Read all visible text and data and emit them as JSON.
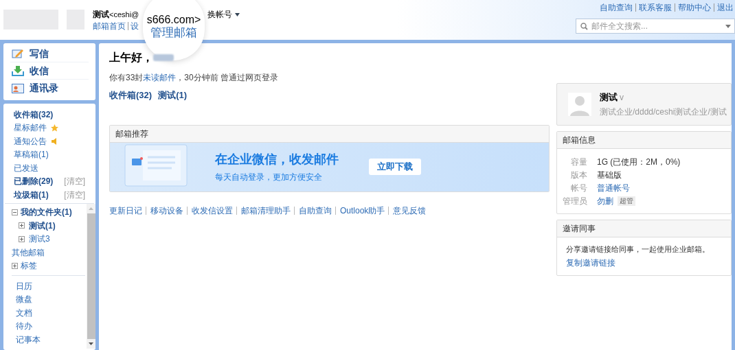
{
  "header": {
    "account_name": "测试",
    "email_visible": "<ceshi@",
    "switch_account": "换帐号",
    "links": [
      "邮箱首页",
      "设"
    ],
    "magnifier": {
      "top_text": "s666.com>",
      "main_text": "管理邮箱"
    },
    "top_links": [
      "自助查询",
      "联系客服",
      "帮助中心",
      "退出"
    ],
    "search": {
      "placeholder": "邮件全文搜索..."
    }
  },
  "quick_actions": [
    {
      "label": "写信",
      "kind": "compose"
    },
    {
      "label": "收信",
      "kind": "receive"
    },
    {
      "label": "通讯录",
      "kind": "contacts"
    }
  ],
  "folders": [
    {
      "label": "收件箱(32)",
      "bold": true,
      "kind": "plain"
    },
    {
      "label": "星标邮件",
      "bold": false,
      "kind": "star"
    },
    {
      "label": "通知公告",
      "bold": false,
      "kind": "notice"
    },
    {
      "label": "草稿箱(1)",
      "bold": false,
      "kind": "plain"
    },
    {
      "label": "已发送",
      "bold": false,
      "kind": "plain"
    },
    {
      "label": "已删除(29)",
      "bold": true,
      "kind": "plain",
      "action": "[清空]"
    },
    {
      "label": "垃圾箱(1)",
      "bold": true,
      "kind": "plain",
      "action": "[清空]"
    }
  ],
  "folder_tree": [
    {
      "label": "我的文件夹(1)",
      "bold": true,
      "expanded": true,
      "children": [
        {
          "label": "测试(1)",
          "bold": true,
          "expanded": false
        },
        {
          "label": "测试3",
          "bold": false,
          "expanded": false
        }
      ]
    },
    {
      "label": "其他邮箱",
      "bold": false
    },
    {
      "label": "标签",
      "bold": false,
      "expanded": false
    }
  ],
  "apps": [
    "日历",
    "微盘",
    "文档",
    "待办",
    "记事本"
  ],
  "main": {
    "greeting": "上午好，",
    "notice_parts": [
      "你有33封",
      "未读邮件",
      "，30分钟前 曾通过网页登录"
    ],
    "shortcuts": [
      "收件箱(32)",
      "测试(1)"
    ],
    "promo": {
      "title": "邮箱推荐",
      "headline": "在企业微信，收发邮件",
      "subline": "每天自动登录，更加方便安全",
      "button": "立即下载"
    },
    "footer_links": [
      "更新日记",
      "移动设备",
      "收发信设置",
      "邮箱清理助手",
      "自助查询",
      "Outlook助手",
      "意见反馈"
    ]
  },
  "profile": {
    "name": "测试",
    "verified_mark": "v",
    "org": "测试企业/dddd/ceshi测试企业/测试"
  },
  "mailbox_info": {
    "title": "邮箱信息",
    "rows": [
      {
        "label": "容量",
        "value": "1G (已使用：2M，0%)",
        "link": false
      },
      {
        "label": "版本",
        "value": "基础版",
        "link": false
      },
      {
        "label": "帐号",
        "value": "普通帐号",
        "link": true
      },
      {
        "label": "管理员",
        "value": "勿删",
        "link": true,
        "tag": "超管"
      }
    ]
  },
  "invite": {
    "title": "邀请同事",
    "text": "分享邀请链接给同事，一起使用企业邮箱。",
    "link": "复制邀请链接"
  }
}
